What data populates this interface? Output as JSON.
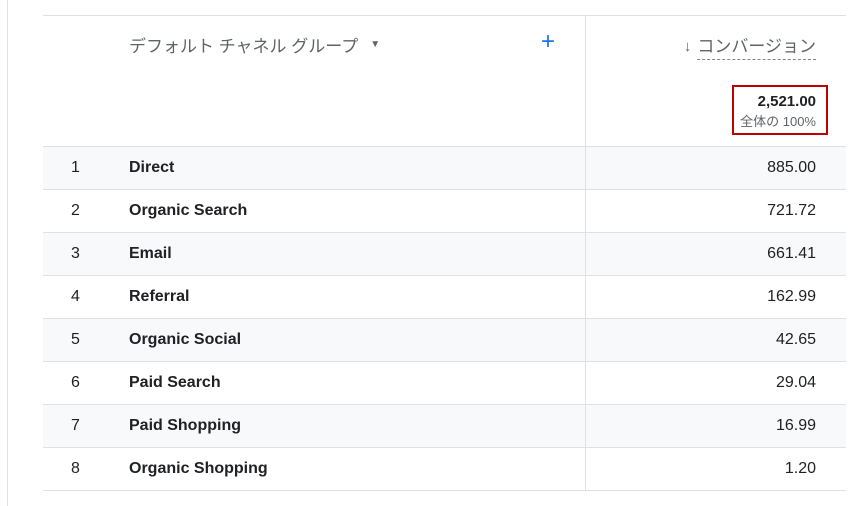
{
  "table": {
    "dimension_header": "デフォルト チャネル グループ",
    "add_dimension_label": "+",
    "sort_icon": "↓",
    "metric_header": "コンバージョン",
    "total": {
      "value": "2,521.00",
      "percent": "全体の 100%"
    },
    "rows": [
      {
        "index": "1",
        "name": "Direct",
        "value": "885.00"
      },
      {
        "index": "2",
        "name": "Organic Search",
        "value": "721.72"
      },
      {
        "index": "3",
        "name": "Email",
        "value": "661.41"
      },
      {
        "index": "4",
        "name": "Referral",
        "value": "162.99"
      },
      {
        "index": "5",
        "name": "Organic Social",
        "value": "42.65"
      },
      {
        "index": "6",
        "name": "Paid Search",
        "value": "29.04"
      },
      {
        "index": "7",
        "name": "Paid Shopping",
        "value": "16.99"
      },
      {
        "index": "8",
        "name": "Organic Shopping",
        "value": "1.20"
      }
    ]
  },
  "colors": {
    "accent": "#1a73e8",
    "highlight_border": "#c00000",
    "row_shade": "#f8f9fa"
  }
}
